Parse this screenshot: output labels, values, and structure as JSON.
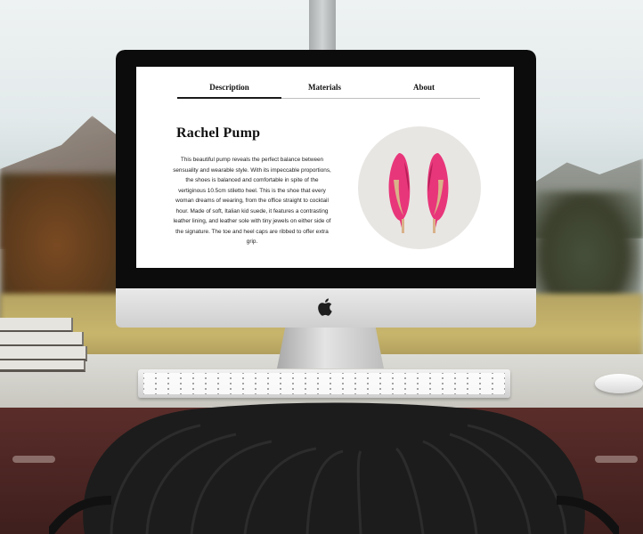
{
  "screen": {
    "tabs": [
      {
        "label": "Description",
        "active": true
      },
      {
        "label": "Materials",
        "active": false
      },
      {
        "label": "About",
        "active": false
      }
    ],
    "product": {
      "title": "Rachel Pump",
      "description": "This beautiful pump reveals the perfect balance between sensuality and wearable style. With its impeccable proportions, the shoes is balanced and comfortable in spite of the vertiginous 10.5cm stiletto heel. This is the shoe that every woman dreams of wearing, from the office straight to cocktail hour. Made of soft, Italian kid suede, it features a contrasting leather lining, and leather sole with tiny jewels on either side of the signature. The toe and heel caps are ribbed to offer extra grip.",
      "image_icon": "pink-stiletto-pumps-icon"
    }
  },
  "colors": {
    "shoe_pink": "#e8367a",
    "shoe_shadow": "#b81f59",
    "sole_tan": "#d9b28a",
    "circle_bg": "#e8e6e3",
    "tab_active": "#1a1a1a",
    "tab_idle": "#bfbfbf"
  },
  "device": {
    "logo_icon": "apple-logo-icon"
  }
}
